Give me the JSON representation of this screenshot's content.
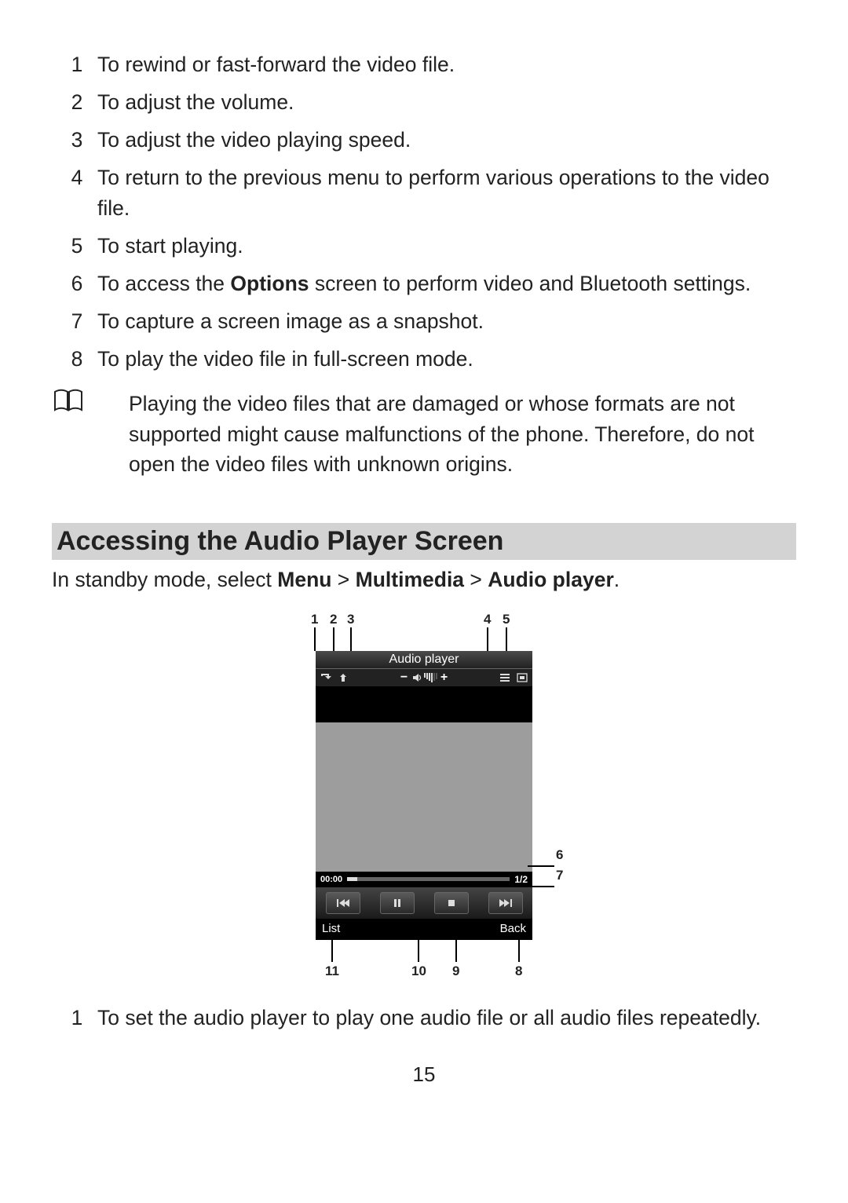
{
  "video_items": [
    {
      "n": "1",
      "t": "To rewind or fast-forward the video file."
    },
    {
      "n": "2",
      "t": "To adjust the volume."
    },
    {
      "n": "3",
      "t": "To adjust the video playing speed."
    },
    {
      "n": "4",
      "t": "To return to the previous menu to perform various operations to the video file."
    },
    {
      "n": "5",
      "t": "To start playing."
    },
    {
      "n": "6",
      "t_pre": "To access the ",
      "t_bold": "Options",
      "t_post": " screen to perform video and Bluetooth settings."
    },
    {
      "n": "7",
      "t": "To capture a screen image as a snapshot."
    },
    {
      "n": "8",
      "t": "To play the video file in full-screen mode."
    }
  ],
  "note_text": "Playing the video files that are damaged or whose formats are not supported might cause malfunctions of the phone. Therefore, do not open the video files with unknown origins.",
  "section_title": "Accessing the Audio Player Screen",
  "intro": {
    "pre": "In standby mode, select ",
    "b1": "Menu",
    "s1": " > ",
    "b2": "Multimedia",
    "s2": " > ",
    "b3": "Audio player",
    "post": "."
  },
  "top_labels": {
    "l1": "1",
    "l2": "2",
    "l3": "3",
    "l4": "4",
    "l5": "5"
  },
  "side_labels": {
    "l6": "6",
    "l7": "7"
  },
  "bot_labels": {
    "l8": "8",
    "l9": "9",
    "l10": "10",
    "l11": "11"
  },
  "phone": {
    "title": "Audio player",
    "time": "00:00",
    "count": "1/2",
    "soft_left": "List",
    "soft_right": "Back"
  },
  "audio_items": [
    {
      "n": "1",
      "t": "To set the audio player to play one audio file or all audio files repeatedly."
    }
  ],
  "page_number": "15"
}
